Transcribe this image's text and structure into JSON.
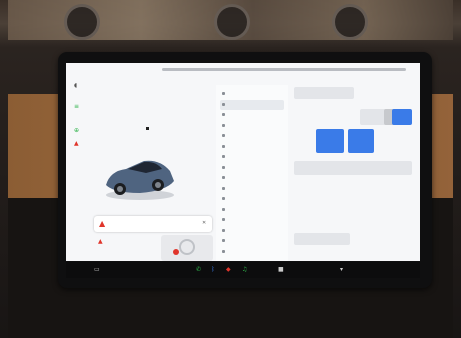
{
  "scene": {
    "caption": "",
    "environment": "garage-dashboard"
  },
  "screen": {
    "status_bar": {
      "left_text": "",
      "time": "",
      "right_text": ""
    },
    "car_labels": {
      "frunk": "",
      "trunk": ""
    },
    "left_icons": [
      {
        "name": "headlights-icon",
        "glyph": "◖"
      },
      {
        "name": "fog-icon",
        "glyph": "≡"
      },
      {
        "name": "autohold-icon",
        "glyph": "⊕"
      },
      {
        "name": "seatbelt-icon",
        "glyph": "▲"
      }
    ],
    "menu_items": [
      {
        "label": "",
        "active": false
      },
      {
        "label": "",
        "active": true
      },
      {
        "label": "",
        "active": false
      },
      {
        "label": "",
        "active": false
      },
      {
        "label": "",
        "active": false
      },
      {
        "label": "",
        "active": false
      },
      {
        "label": "",
        "active": false
      },
      {
        "label": "",
        "active": false
      },
      {
        "label": "",
        "active": false
      },
      {
        "label": "",
        "active": false
      },
      {
        "label": "",
        "active": false
      },
      {
        "label": "",
        "active": false
      },
      {
        "label": "",
        "active": false
      },
      {
        "label": "",
        "active": false
      },
      {
        "label": "",
        "active": false
      },
      {
        "label": "",
        "active": false
      }
    ],
    "alert": {
      "text": ""
    },
    "charge": {
      "text": ""
    },
    "panel_tiles": [
      {
        "label": "",
        "style": "light"
      },
      {
        "label": "",
        "style": "light"
      },
      {
        "label": "",
        "style": "grey"
      },
      {
        "label": "",
        "style": "blue"
      },
      {
        "label": "",
        "style": "blue"
      },
      {
        "label": "",
        "style": "blue"
      },
      {
        "label": "",
        "style": "light"
      },
      {
        "label": "",
        "style": "light"
      }
    ]
  },
  "taskbar": {
    "icons": [
      {
        "name": "car-icon",
        "glyph": "▭"
      },
      {
        "name": "phone-icon",
        "glyph": "✆"
      },
      {
        "name": "bluetooth-icon",
        "glyph": "ᛒ"
      },
      {
        "name": "apps-icon",
        "glyph": "◆"
      },
      {
        "name": "music-icon",
        "glyph": "♫"
      },
      {
        "name": "media-icon",
        "glyph": "■"
      },
      {
        "name": "volume-icon",
        "glyph": "▾"
      }
    ],
    "colors": {
      "accent_blue": "#3a7be8",
      "alert_red": "#e0352b",
      "green": "#2fb34a"
    }
  }
}
